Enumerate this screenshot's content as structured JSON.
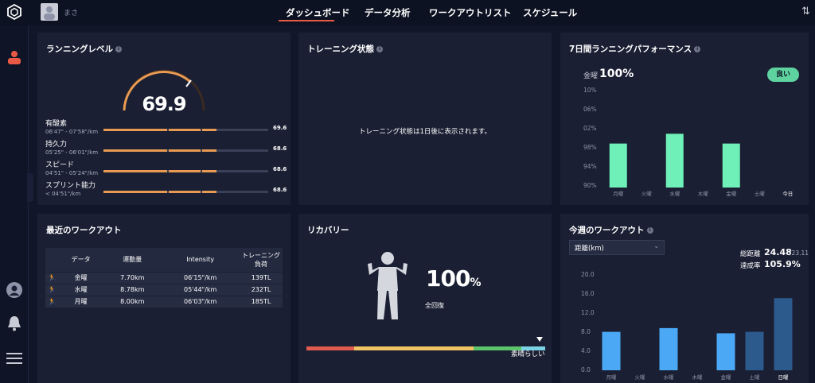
{
  "header": {
    "user_name": "まさ",
    "nav": [
      "ダッシュボード",
      "データ分析",
      "ワークアウトリスト",
      "スケジュール"
    ],
    "active_nav": "ダッシュボード",
    "sort_icon": "sort-arrows-icon"
  },
  "sidebar": {
    "icons": [
      "runner-user-icon",
      "avatar-icon",
      "bell-icon",
      "menu-icon"
    ]
  },
  "colors": {
    "accent_red": "#e85a45",
    "orange": "#e89a52",
    "mint": "#6ef0b8",
    "blue": "#4aa8f5",
    "navy_bar": "#2d5a8c"
  },
  "running_level": {
    "title": "ランニングレベル",
    "value": "69.9",
    "rows": [
      {
        "name": "有酸素",
        "range": "06'47\" - 07'58\"/km",
        "value": "69.6"
      },
      {
        "name": "持久力",
        "range": "05'25\" - 06'01\"/km",
        "value": "68.6"
      },
      {
        "name": "スピード",
        "range": "04'51\" - 05'24\"/km",
        "value": "68.6"
      },
      {
        "name": "スプリント能力",
        "range": "< 04'51\"/km",
        "value": "68.6"
      }
    ]
  },
  "training_status": {
    "title": "トレーニング状態",
    "message": "トレーニング状態は1日後に表示されます。"
  },
  "performance": {
    "title": "7日間ランニングパフォーマンス",
    "day": "金曜",
    "value": "100%",
    "badge": "良い",
    "y_ticks": [
      "10%",
      "06%",
      "02%",
      "98%",
      "94%",
      "90%"
    ],
    "chart_data": {
      "type": "bar",
      "categories": [
        "月曜",
        "火曜",
        "水曜",
        "木曜",
        "金曜",
        "土曜",
        "今日"
      ],
      "values": [
        99,
        null,
        101,
        null,
        99,
        null,
        null
      ],
      "ylim": [
        90,
        110
      ],
      "color": "#6ef0b8"
    }
  },
  "recent_workouts": {
    "title": "最近のワークアウト",
    "columns": [
      "データ",
      "運動量",
      "Intensity",
      "トレーニング負荷"
    ],
    "rows": [
      {
        "icon": "runner-icon",
        "day": "金曜",
        "amount": "7.70km",
        "intensity": "06'15\"/km",
        "load": "139TL"
      },
      {
        "icon": "runner-icon",
        "day": "水曜",
        "amount": "8.78km",
        "intensity": "05'44\"/km",
        "load": "232TL"
      },
      {
        "icon": "runner-icon",
        "day": "月曜",
        "amount": "8.00km",
        "intensity": "06'03\"/km",
        "load": "185TL"
      }
    ]
  },
  "recovery": {
    "title": "リカバリー",
    "percent": "100",
    "percent_unit": "%",
    "status": "全回復",
    "label": "素晴らしい",
    "level": 1.0
  },
  "weekly": {
    "title": "今週のワークアウト",
    "select": "距離(km)",
    "total_label": "総距離",
    "total_value": "24.48",
    "total_target": "/23.11",
    "rate_label": "達成率",
    "rate_value": "105.9%",
    "y_ticks": [
      "20.0",
      "16.0",
      "12.0",
      "8.0",
      "4.0",
      "0.0"
    ],
    "chart_data": {
      "type": "bar",
      "categories": [
        "月曜",
        "火曜",
        "水曜",
        "木曜",
        "金曜",
        "土曜",
        "日曜"
      ],
      "values": [
        8.0,
        0,
        8.78,
        0,
        7.7,
        8.0,
        15.0
      ],
      "ylim": [
        0,
        20
      ],
      "colors": [
        "#4aa8f5",
        "#4aa8f5",
        "#4aa8f5",
        "#4aa8f5",
        "#4aa8f5",
        "#2d5a8c",
        "#2d5a8c"
      ]
    }
  }
}
